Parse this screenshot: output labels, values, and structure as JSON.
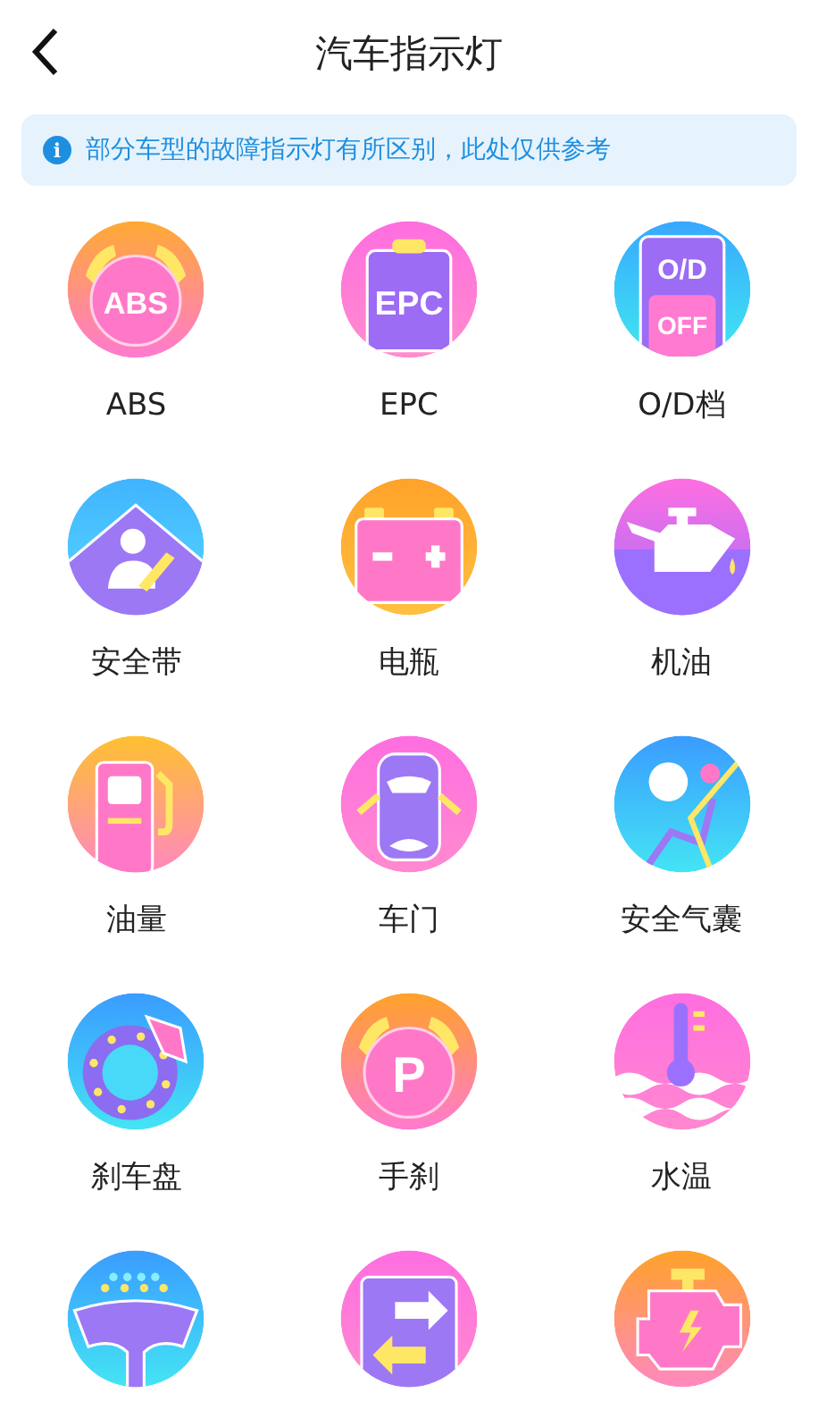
{
  "header": {
    "title": "汽车指示灯"
  },
  "notice": {
    "icon": "i",
    "text": "部分车型的故障指示灯有所区别，此处仅供参考"
  },
  "items": [
    {
      "kind": "abs",
      "icon_text": [
        "ABS"
      ],
      "label": "ABS"
    },
    {
      "kind": "epc",
      "icon_text": [
        "EPC"
      ],
      "label": "EPC"
    },
    {
      "kind": "od",
      "icon_text": [
        "O/D",
        "OFF"
      ],
      "label": "O/D档"
    },
    {
      "kind": "seatbelt",
      "label": "安全带"
    },
    {
      "kind": "battery",
      "label": "电瓶"
    },
    {
      "kind": "oil",
      "label": "机油"
    },
    {
      "kind": "fuel",
      "label": "油量"
    },
    {
      "kind": "door",
      "label": "车门"
    },
    {
      "kind": "airbag",
      "label": "安全气囊"
    },
    {
      "kind": "brake",
      "label": "刹车盘"
    },
    {
      "kind": "handbrake",
      "icon_text": [
        "P"
      ],
      "label": "手刹"
    },
    {
      "kind": "temp",
      "label": "水温"
    },
    {
      "kind": "washer"
    },
    {
      "kind": "turn"
    },
    {
      "kind": "engine"
    }
  ]
}
